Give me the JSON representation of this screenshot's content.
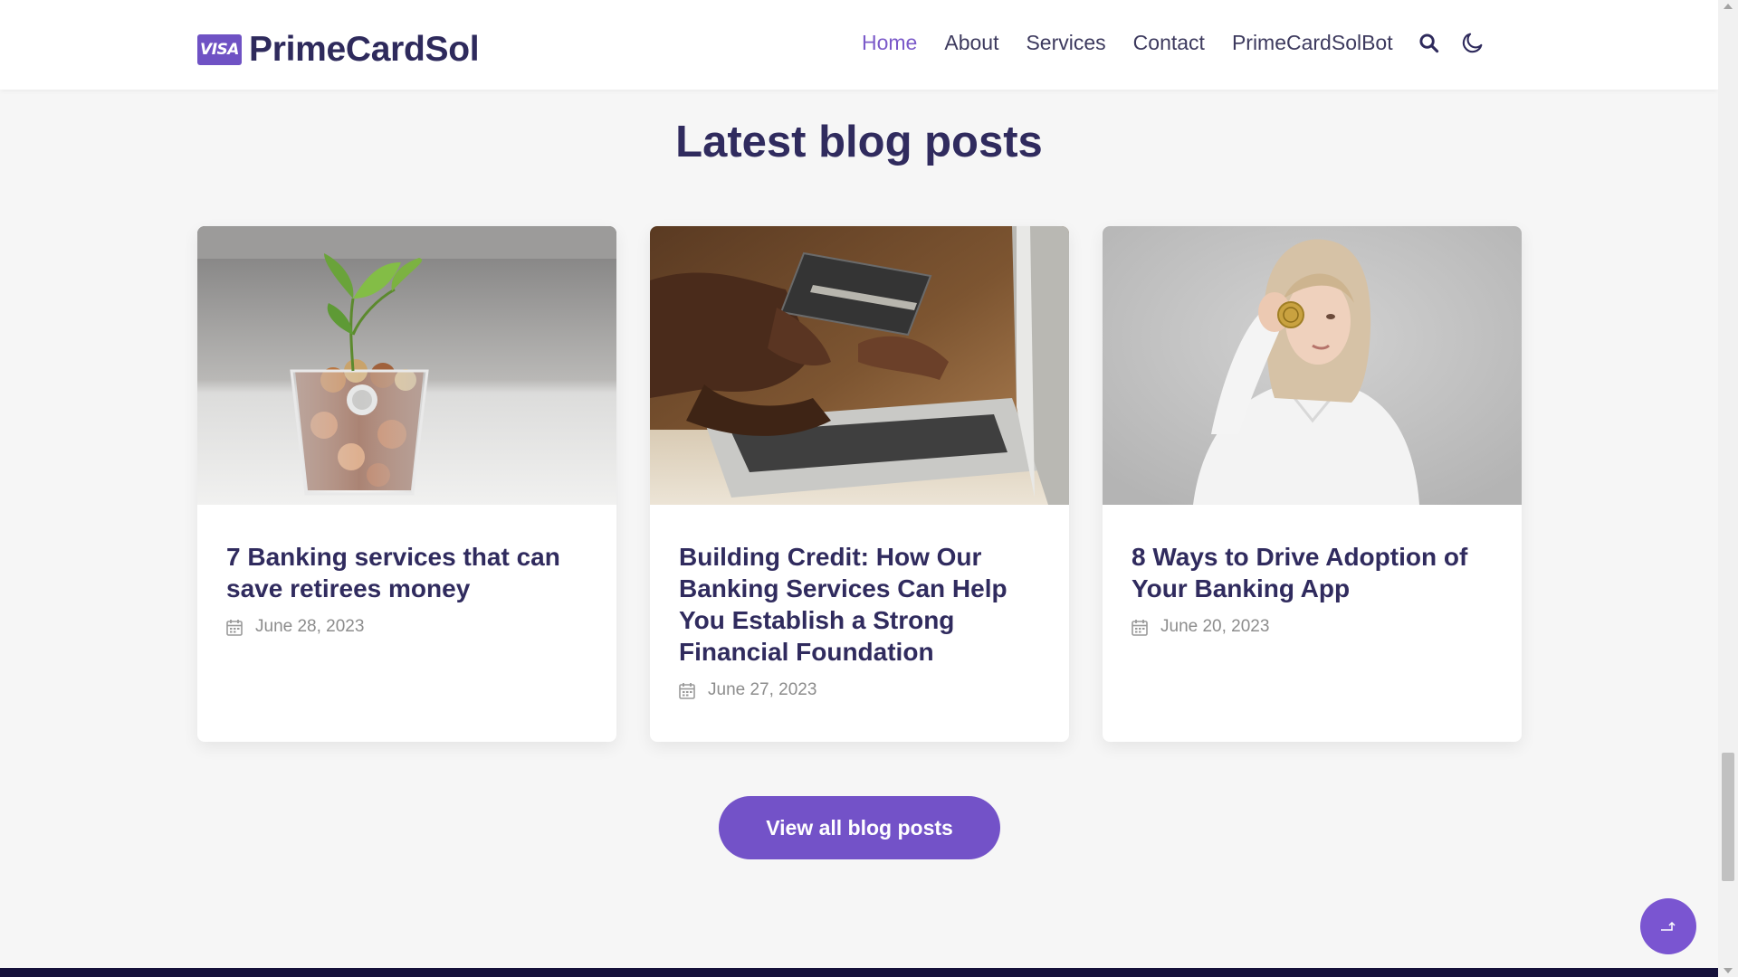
{
  "header": {
    "logo_badge": "VISA",
    "logo_text": "PrimeCardSol",
    "nav": [
      {
        "label": "Home",
        "active": true
      },
      {
        "label": "About",
        "active": false
      },
      {
        "label": "Services",
        "active": false
      },
      {
        "label": "Contact",
        "active": false
      },
      {
        "label": "PrimeCardSolBot",
        "active": false
      }
    ],
    "icons": [
      "search-icon",
      "moon-icon"
    ]
  },
  "blog": {
    "title": "Latest blog posts",
    "posts": [
      {
        "title": "7 Banking services that can save retirees money",
        "date": "June 28, 2023",
        "image": "plant-in-coin-jar"
      },
      {
        "title": "Building Credit: How Our Banking Services Can Help You Establish a Strong Financial Foundation",
        "date": "June 27, 2023",
        "image": "credit-card-laptop"
      },
      {
        "title": "8 Ways to Drive Adoption of Your Banking App",
        "date": "June 20, 2023",
        "image": "woman-holding-coin"
      }
    ],
    "view_all_label": "View all blog posts"
  },
  "colors": {
    "accent": "#7352c8",
    "heading": "#302b5e",
    "page_bg": "#f6f6f6",
    "footer": "#15113a"
  }
}
